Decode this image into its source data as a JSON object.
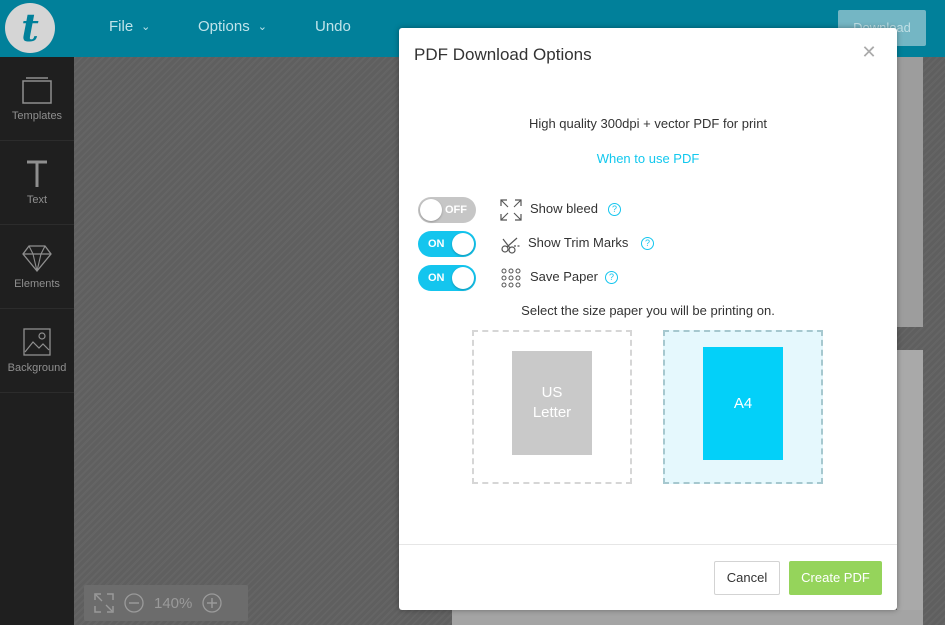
{
  "header": {
    "logo_letter": "t",
    "menu": [
      {
        "label": "File"
      },
      {
        "label": "Options"
      },
      {
        "label": "Undo"
      }
    ],
    "download_label": "Download"
  },
  "sidebar": {
    "items": [
      {
        "label": "Templates",
        "icon": "templates-icon"
      },
      {
        "label": "Text",
        "icon": "text-icon"
      },
      {
        "label": "Elements",
        "icon": "diamond-icon"
      },
      {
        "label": "Background",
        "icon": "image-icon"
      }
    ]
  },
  "zoom": {
    "level": "140%"
  },
  "dialog": {
    "title": "PDF Download Options",
    "subtitle": "High quality 300dpi + vector PDF for print",
    "help_link": "When to use PDF",
    "options": [
      {
        "label": "Show bleed",
        "state": "OFF",
        "on": false,
        "icon": "expand-icon"
      },
      {
        "label": "Show Trim Marks",
        "state": "ON",
        "on": true,
        "icon": "scissors-icon"
      },
      {
        "label": "Save Paper",
        "state": "ON",
        "on": true,
        "icon": "grid-dots-icon"
      }
    ],
    "help_glyph": "?",
    "paper_prompt": "Select the size paper you will be printing on.",
    "papers": [
      {
        "label": "US Letter",
        "selected": false
      },
      {
        "label": "A4",
        "selected": true
      }
    ],
    "cancel_label": "Cancel",
    "create_label": "Create PDF"
  },
  "colors": {
    "header": "#01809a",
    "accent": "#14c5ee",
    "create_button": "#95d45b",
    "sidebar": "#1f1f1f"
  }
}
